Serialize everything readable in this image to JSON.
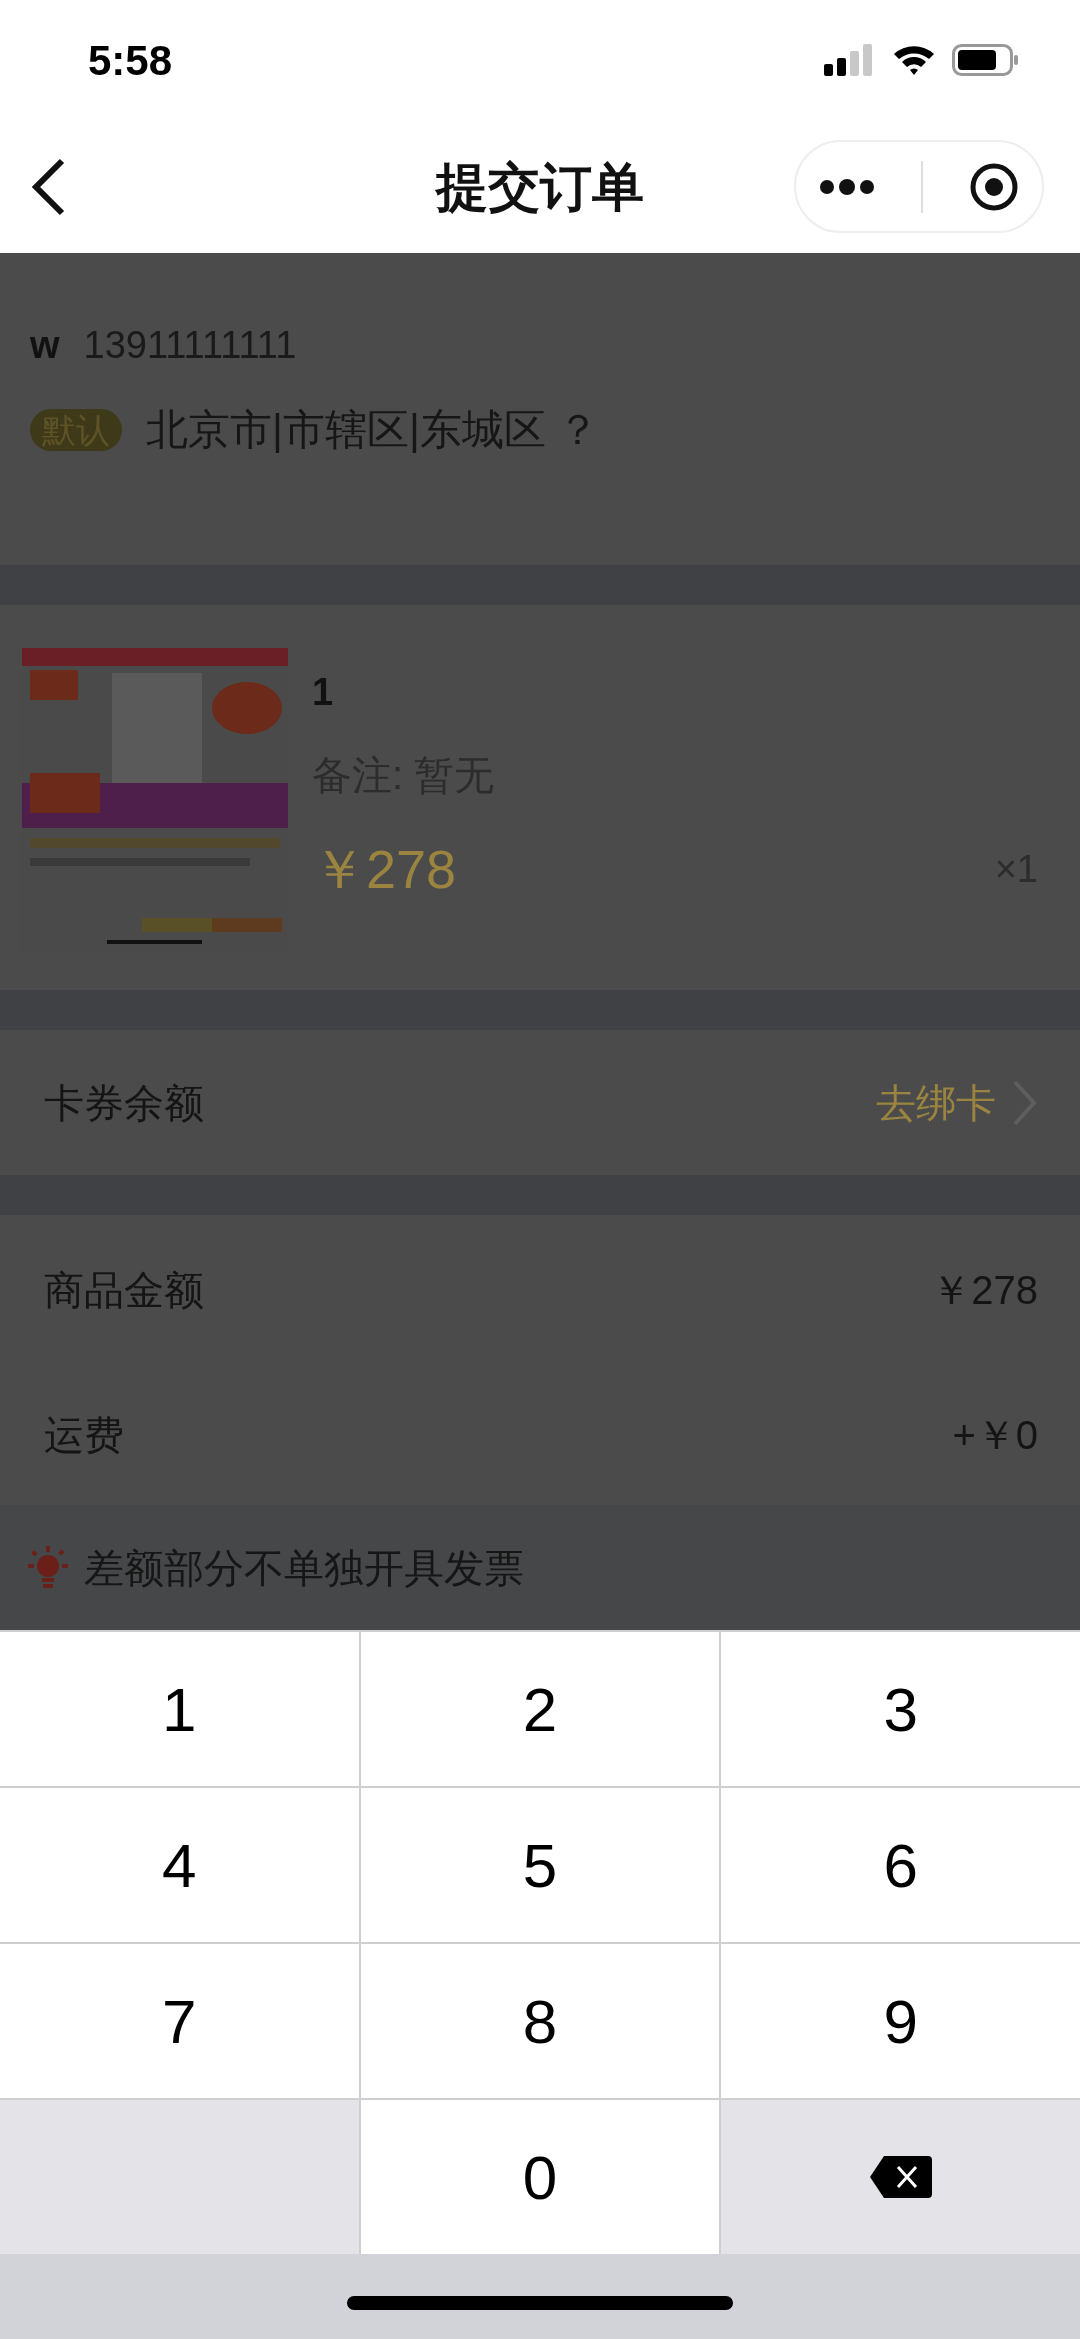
{
  "status_bar": {
    "time": "5:58"
  },
  "nav": {
    "title": "提交订单"
  },
  "address": {
    "name": "w",
    "phone": "13911111111",
    "tag": "默认",
    "text": "北京市|市辖区|东城区 ？"
  },
  "product": {
    "title": "1",
    "note": "备注: 暂无",
    "price": "￥278",
    "quantity": "×1"
  },
  "card_row": {
    "label": "卡券余额",
    "action": "去绑卡"
  },
  "summary": [
    {
      "label": "商品金额",
      "value": "￥278"
    },
    {
      "label": "运费",
      "value": "+￥0"
    }
  ],
  "notice": {
    "text": "差额部分不单独开具发票"
  },
  "keypad": [
    {
      "kind": "digit",
      "label": "1"
    },
    {
      "kind": "digit",
      "label": "2"
    },
    {
      "kind": "digit",
      "label": "3"
    },
    {
      "kind": "digit",
      "label": "4"
    },
    {
      "kind": "digit",
      "label": "5"
    },
    {
      "kind": "digit",
      "label": "6"
    },
    {
      "kind": "digit",
      "label": "7"
    },
    {
      "kind": "digit",
      "label": "8"
    },
    {
      "kind": "digit",
      "label": "9"
    },
    {
      "kind": "blank"
    },
    {
      "kind": "digit",
      "label": "0"
    },
    {
      "kind": "backspace"
    }
  ]
}
